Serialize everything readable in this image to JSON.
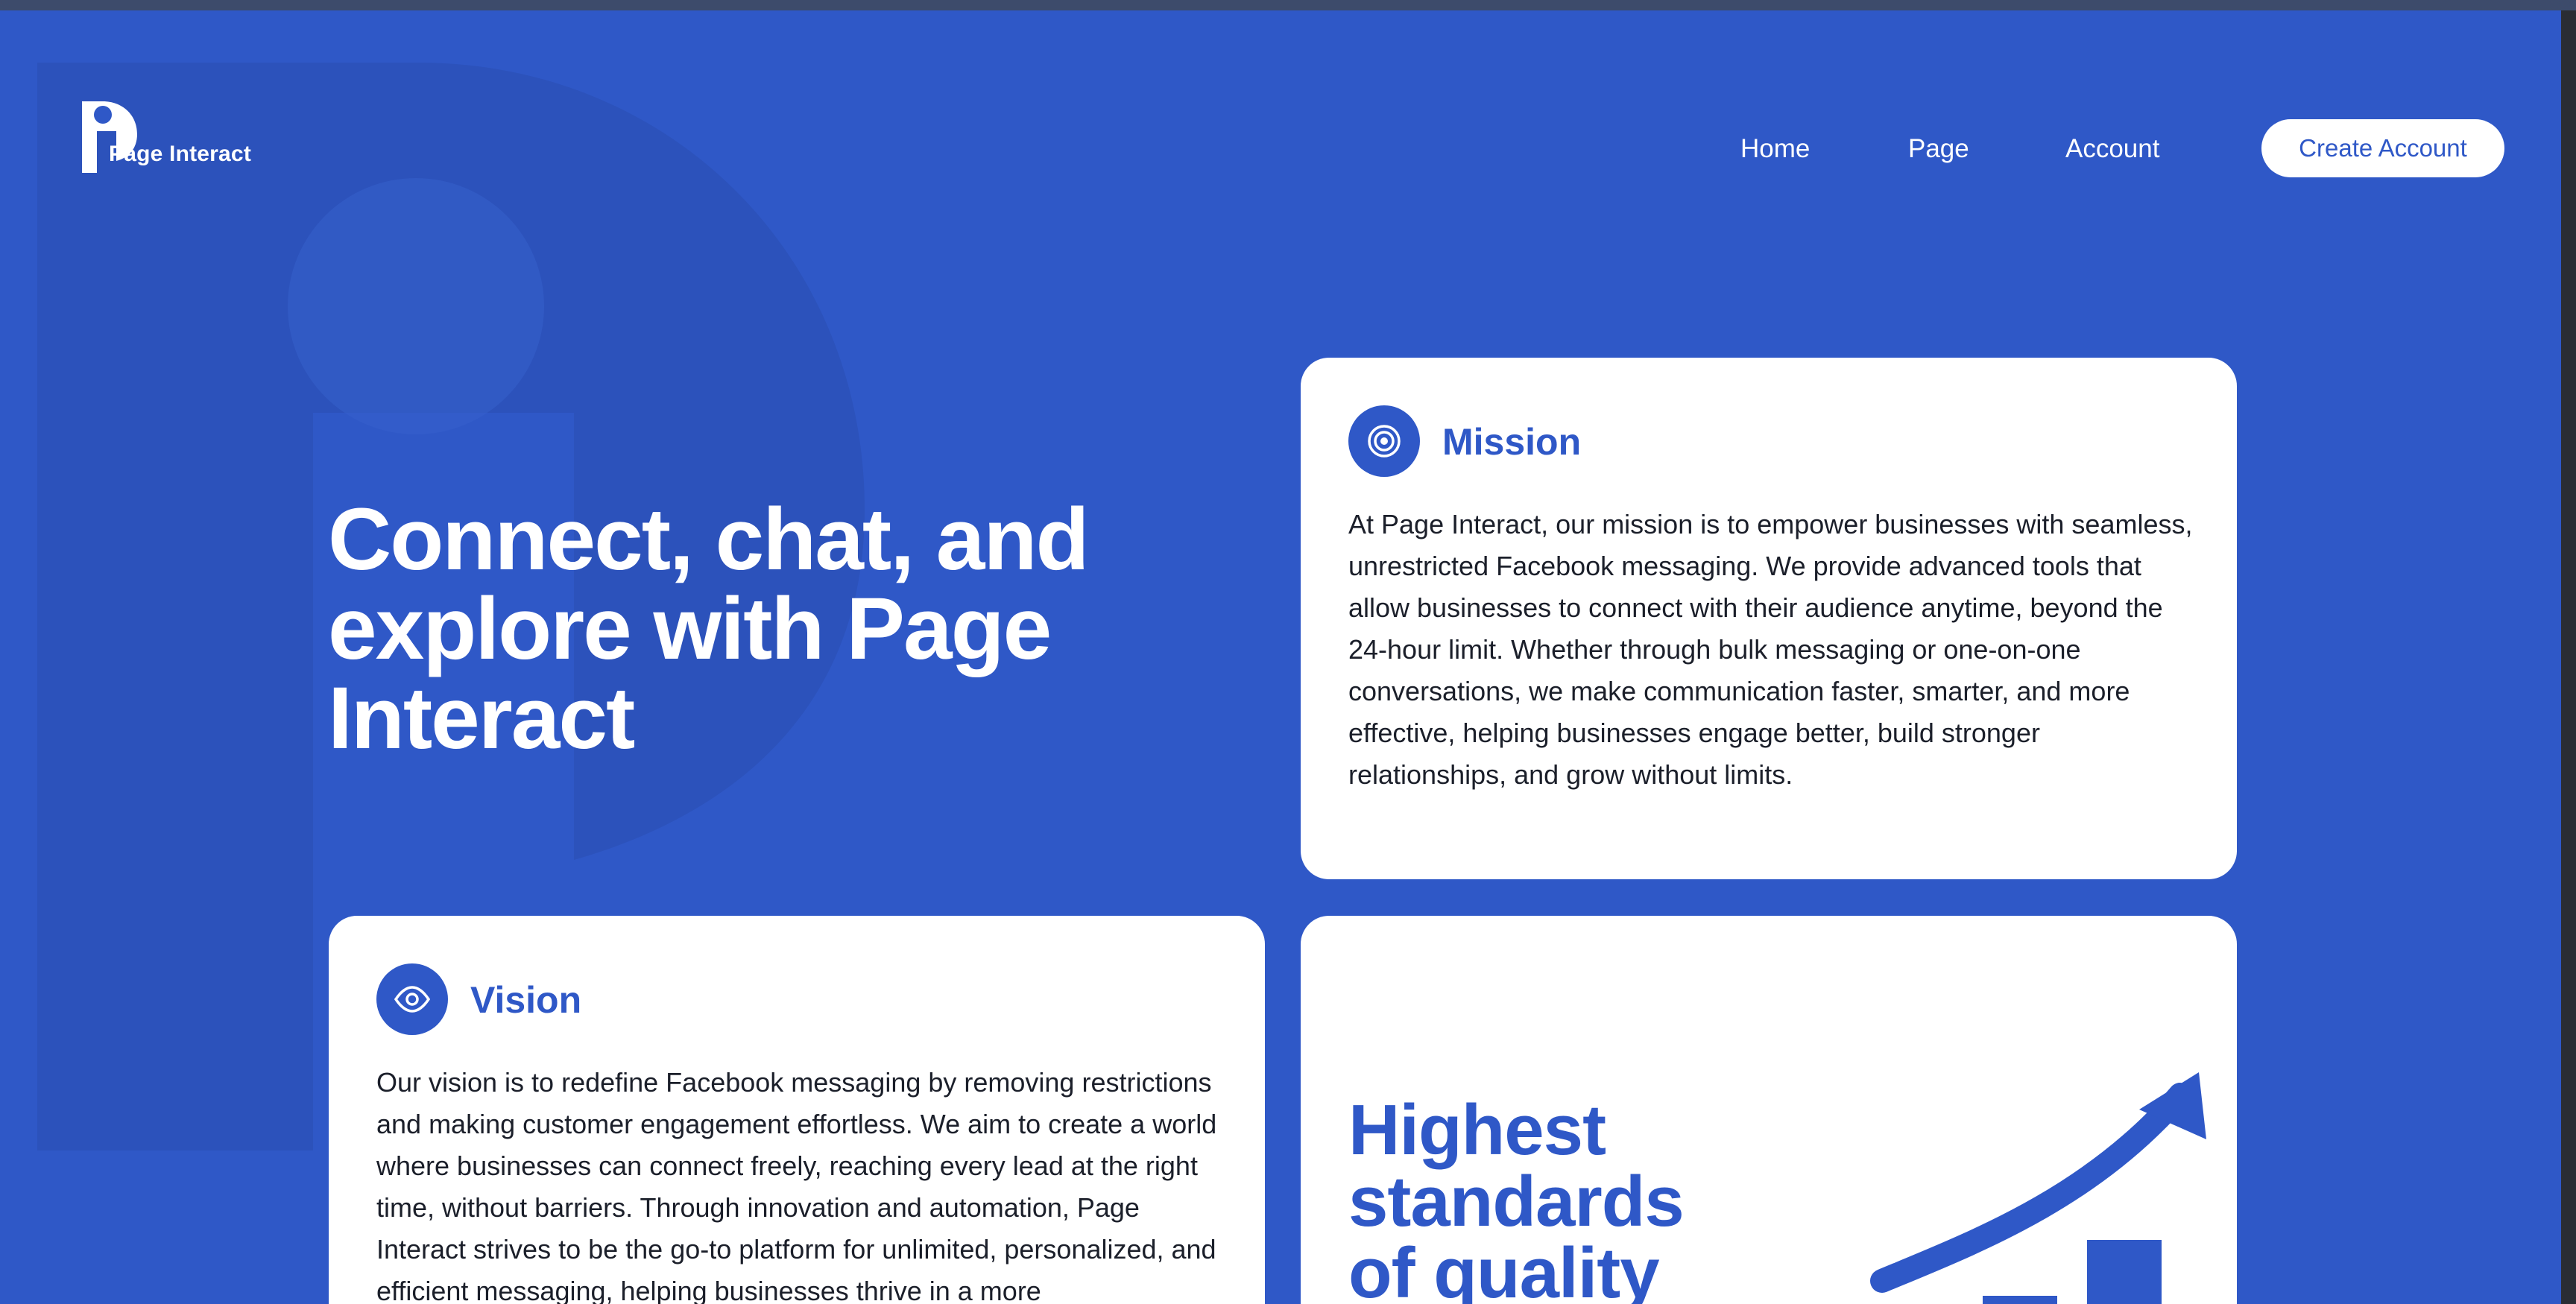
{
  "brand": {
    "name": "Page Interact"
  },
  "nav": {
    "home": "Home",
    "page": "Page",
    "account": "Account",
    "cta": "Create Account"
  },
  "hero": {
    "title": "Connect, chat, and explore with Page Interact"
  },
  "mission": {
    "icon": "target-icon",
    "heading": "Mission",
    "body": "At Page Interact, our mission is to empower businesses with seamless, unrestricted Facebook messaging. We provide advanced tools that allow businesses to connect with their audience anytime, beyond the 24-hour limit. Whether through bulk messaging or one-on-one conversations, we make communication faster, smarter, and more effective, helping businesses engage better, build stronger relationships, and grow without limits."
  },
  "vision": {
    "icon": "eye-icon",
    "heading": "Vision",
    "body": "Our vision is to redefine Facebook messaging by removing restrictions and making customer engagement effortless. We aim to create a world where businesses can connect freely, reaching every lead at the right time, without barriers. Through innovation and automation, Page Interact strives to be the go-to platform for unlimited, personalized, and efficient messaging, helping businesses thrive in a more"
  },
  "quality": {
    "title": "Highest standards of quality",
    "icon": "growth-chart-icon"
  },
  "colors": {
    "brand_blue": "#2f58c7",
    "white": "#ffffff",
    "text_dark": "#1b1f2a"
  }
}
